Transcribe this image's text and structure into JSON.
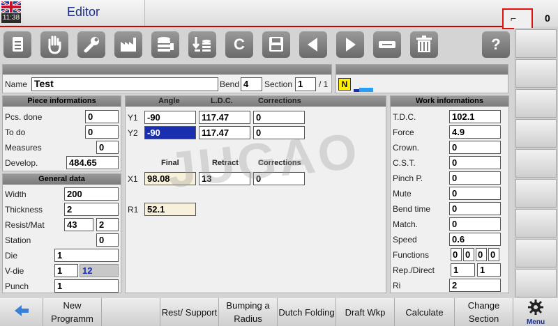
{
  "header": {
    "clock": "11:38",
    "title": "Editor",
    "counter": "0"
  },
  "toolbar": {
    "icons": [
      "document-icon",
      "hand-icon",
      "wrench-icon",
      "factory-icon",
      "database-icon",
      "import-icon",
      "clear-icon",
      "save-icon",
      "prev-icon",
      "next-icon",
      "minus-icon",
      "trash-icon",
      "help-icon"
    ],
    "clear_label": "C",
    "help_label": "?"
  },
  "name_row": {
    "name_label": "Name",
    "name_value": "Test",
    "bend_label": "Bend",
    "bend_value": "4",
    "section_label": "Section",
    "section_value": "1",
    "section_total": "/ 1",
    "mode_badge": "N"
  },
  "piece": {
    "title": "Piece informations",
    "pcs_done_label": "Pcs. done",
    "pcs_done": "0",
    "to_do_label": "To do",
    "to_do": "0",
    "measures_label": "Measures",
    "measures": "0",
    "develop_label": "Develop.",
    "develop": "484.65"
  },
  "general": {
    "title": "General data",
    "width_label": "Width",
    "width": "200",
    "thickness_label": "Thickness",
    "thickness": "2",
    "resist_label": "Resist/Mat",
    "resist": "43",
    "mat": "2",
    "station_label": "Station",
    "station": "0",
    "die_label": "Die",
    "die": "1",
    "vdie_label": "V-die",
    "vdie": "1",
    "vdie2": "12",
    "punch_label": "Punch",
    "punch": "1"
  },
  "bend": {
    "angle_h": "Angle",
    "ldc_h": "L.D.C.",
    "corr_h": "Corrections",
    "y1_label": "Y1",
    "y1_angle": "-90",
    "y1_ldc": "117.47",
    "y1_corr": "0",
    "y2_label": "Y2",
    "y2_angle": "-90",
    "y2_ldc": "117.47",
    "y2_corr": "0",
    "final_h": "Final",
    "retract_h": "Retract",
    "corr2_h": "Corrections",
    "x1_label": "X1",
    "x1_final": "98.08",
    "x1_retract": "13",
    "x1_corr": "0",
    "r1_label": "R1",
    "r1": "52.1"
  },
  "work": {
    "title": "Work informations",
    "tdc_label": "T.D.C.",
    "tdc": "102.1",
    "force_label": "Force",
    "force": "4.9",
    "crown_label": "Crown.",
    "crown": "0",
    "cst_label": "C.S.T.",
    "cst": "0",
    "pinch_label": "Pinch P.",
    "pinch": "0",
    "mute_label": "Mute",
    "mute": "0",
    "bendtime_label": "Bend time",
    "bendtime": "0",
    "match_label": "Match.",
    "match": "0",
    "speed_label": "Speed",
    "speed": "0.6",
    "functions_label": "Functions",
    "f1": "0",
    "f2": "0",
    "f3": "0",
    "f4": "0",
    "rep_label": "Rep./Direct",
    "rep": "1",
    "direct": "1",
    "ri_label": "Ri",
    "ri": "2"
  },
  "watermark": "JUGAO",
  "bottom": {
    "new_programm": "New Programm",
    "rest_support": "Rest/ Support",
    "bumping": "Bumping a Radius",
    "dutch": "Dutch Folding",
    "draft": "Draft Wkp",
    "calculate": "Calculate",
    "change": "Change Section",
    "menu": "Menu"
  },
  "colors": {
    "accent": "#1c2f8a",
    "selected": "#1a2fb0",
    "red": "#e01010"
  }
}
